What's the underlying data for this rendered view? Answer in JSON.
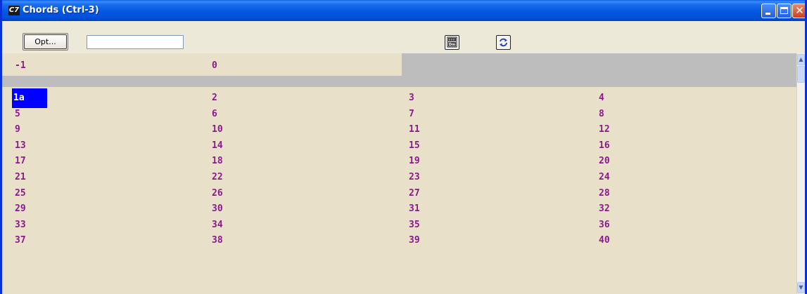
{
  "window": {
    "icon_text": "C7",
    "title": "Chords (Ctrl-3)"
  },
  "toolbar": {
    "opt_label": "Opt...",
    "input_value": ""
  },
  "grid": {
    "top_row": [
      "-1",
      "0"
    ],
    "rows": [
      [
        "1a",
        "2",
        "3",
        "4"
      ],
      [
        "5",
        "6",
        "7",
        "8"
      ],
      [
        "9",
        "10",
        "11",
        "12"
      ],
      [
        "13",
        "14",
        "15",
        "16"
      ],
      [
        "17",
        "18",
        "19",
        "20"
      ],
      [
        "21",
        "22",
        "23",
        "24"
      ],
      [
        "25",
        "26",
        "27",
        "28"
      ],
      [
        "29",
        "30",
        "31",
        "32"
      ],
      [
        "33",
        "34",
        "35",
        "36"
      ],
      [
        "37",
        "38",
        "39",
        "40"
      ]
    ],
    "selected_cell": "1a"
  },
  "icons": {
    "app": "app-logo-icon",
    "minimize": "minimize-icon",
    "maximize": "maximize-icon",
    "close": "close-icon",
    "chord_display": "chord-display-icon",
    "refresh": "refresh-icon"
  },
  "colors": {
    "cell_text": "#8a1a8a",
    "selection": "#0000ff",
    "content_bg": "#e8e0c8",
    "band_gray": "#bdbdbd"
  }
}
